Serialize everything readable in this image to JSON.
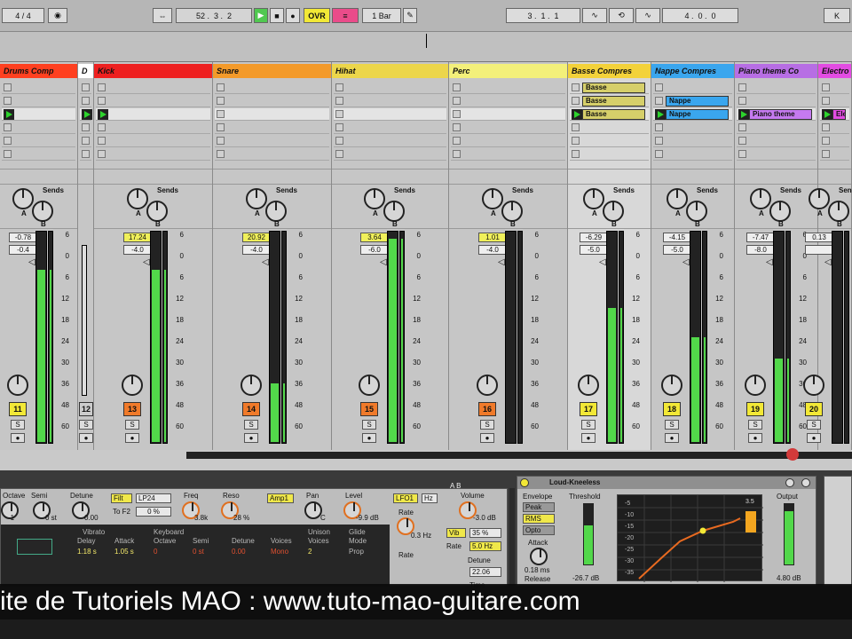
{
  "transport": {
    "time_sig": "4 / 4",
    "position": "52 .  3 .  2",
    "ovr": "OVR",
    "quantize": "1 Bar",
    "loop_start": "3 .  1 .  1",
    "loop_length": "4 .  0 .  0",
    "key_label": "K"
  },
  "tracks": [
    {
      "name": "Drums Comp",
      "color": "#ff4020",
      "num": "11",
      "vol": "-0.78",
      "pan": "-0.4",
      "meter": 0.82,
      "num_color": "#f2e836",
      "clips": [
        "",
        "",
        ""
      ],
      "clip_color": "#ff4020"
    },
    {
      "name": "D",
      "color": "#ffffff",
      "num": "12",
      "vol": "",
      "pan": "",
      "meter": 0.0,
      "num_color": "#ccc",
      "clips": [
        "",
        "",
        ""
      ],
      "clip_color": "#ffffff"
    },
    {
      "name": "Kick",
      "color": "#ee2020",
      "num": "13",
      "vol": "17.24",
      "pan": "-4.0",
      "meter": 0.82,
      "num_color": "#f07a2a",
      "clips": [
        "",
        "",
        ""
      ],
      "clip_color": "#ee2020"
    },
    {
      "name": "Snare",
      "color": "#f39a2a",
      "num": "14",
      "vol": "20.92",
      "pan": "-4.0",
      "meter": 0.28,
      "num_color": "#f07a2a",
      "clips": [
        "",
        "",
        ""
      ],
      "clip_color": "#f39a2a"
    },
    {
      "name": "Hihat",
      "color": "#ecd64a",
      "num": "15",
      "vol": "3.64",
      "pan": "-6.0",
      "meter": 0.97,
      "num_color": "#f07a2a",
      "clips": [
        "",
        "",
        ""
      ],
      "clip_color": "#ecd64a"
    },
    {
      "name": "Perc",
      "color": "#f3f07a",
      "num": "16",
      "vol": "1.01",
      "pan": "-4.0",
      "meter": 0.0,
      "num_color": "#f07a2a",
      "clips": [
        "",
        "",
        ""
      ],
      "clip_color": "#f3f07a"
    },
    {
      "name": "Basse Compres",
      "color": "#f3d23a",
      "num": "17",
      "vol": "-6.29",
      "pan": "-5.0",
      "meter": 0.64,
      "num_color": "#f2e836",
      "clips": [
        "Basse",
        "Basse",
        "Basse"
      ],
      "clip_color": "#d6cf6a"
    },
    {
      "name": "Nappe Compres",
      "color": "#3aa6ee",
      "num": "18",
      "vol": "-4.15",
      "pan": "-5.0",
      "meter": 0.5,
      "num_color": "#f2e836",
      "clips": [
        "",
        "Nappe",
        "Nappe"
      ],
      "clip_color": "#3aa6ee"
    },
    {
      "name": "Piano theme Co",
      "color": "#b76ee4",
      "num": "19",
      "vol": "-7.47",
      "pan": "-8.0",
      "meter": 0.4,
      "num_color": "#f2e836",
      "clips": [
        "",
        "",
        "Piano theme"
      ],
      "clip_color": "#c57af0"
    },
    {
      "name": "Electro",
      "color": "#e24ce2",
      "num": "20",
      "vol": "0.13",
      "pan": "",
      "meter": 0.0,
      "num_color": "#f2e836",
      "clips": [
        "",
        "",
        "Elec"
      ],
      "clip_color": "#e24ce2"
    }
  ],
  "scale_marks": [
    "6",
    "0",
    "6",
    "12",
    "18",
    "24",
    "30",
    "36",
    "48",
    "60"
  ],
  "sends_label": "Sends",
  "send_a": "A",
  "send_b": "B",
  "solo": "S",
  "synth": {
    "octave": "Octave",
    "semi": "Semi",
    "detune": "Detune",
    "octave_val": "-1",
    "semi_val": "0 st",
    "detune_val": "0.00",
    "filter": "Filt",
    "filter_type": "LP24",
    "to_f2": "To F2",
    "to_f2_val": "0 %",
    "freq": "Freq",
    "freq_val": "3.8k",
    "reso": "Reso",
    "reso_val": "28 %",
    "amp": "Amp1",
    "pan": "Pan",
    "pan_val": "C",
    "level": "Level",
    "level_val": "-9.9 dB",
    "lfo": "LFO1",
    "hz": "Hz",
    "rate": "Rate",
    "rate_val": "0.3 Hz",
    "rate2": "Rate",
    "volume": "Volume",
    "volume_val": "-3.0 dB",
    "vib": "Vib",
    "vib_val": "35 %",
    "rate3": "Rate",
    "rate3_val": "5.0 Hz",
    "detune2": "Detune",
    "detune2_val": "22.06",
    "vibrato": "Vibrato",
    "delay": "Delay",
    "delay_val": "1.18 s",
    "attack": "Attack",
    "attack_val": "1.05 s",
    "keyboard": "Keyboard",
    "octave2": "Octave",
    "octave2_val": "0",
    "semi2": "Semi",
    "semi2_val": "0 st",
    "detune3": "Detune",
    "detune3_val": "0.00",
    "voices": "Voices",
    "voices_val": "Mono",
    "unison": "Unison",
    "unison_voices": "Voices",
    "unison_val": "2",
    "glide": "Glide",
    "mode": "Mode",
    "mode_val": "Prop",
    "ab": "A  B",
    "time": "Time"
  },
  "compressor": {
    "title": "Loud-Kneeless",
    "envelope": "Envelope",
    "peak": "Peak",
    "rms": "RMS",
    "opto": "Opto",
    "threshold": "Threshold",
    "attack": "Attack",
    "attack_val": "0.18 ms",
    "release": "Release",
    "threshold_val": "-26.7 dB",
    "output": "Output",
    "output_val": "4.80 dB",
    "y_ticks": [
      "-5",
      "-10",
      "-15",
      "-20",
      "-25",
      "-30",
      "-35"
    ],
    "gr_val": "3.5"
  },
  "banner": {
    "text": "ite de Tutoriels MAO : www.tuto-mao-guitare.com"
  }
}
